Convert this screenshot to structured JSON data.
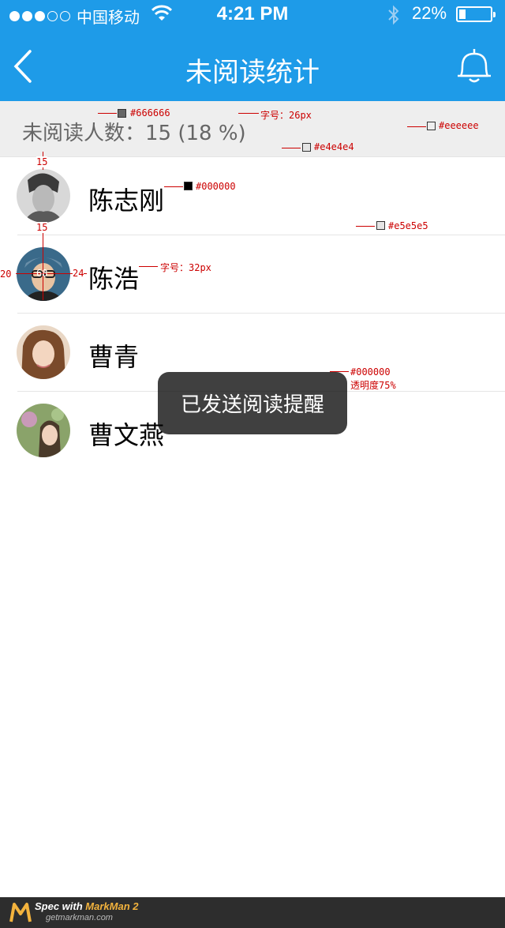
{
  "status_bar": {
    "carrier": "中国移动",
    "time": "4:21 PM",
    "battery_text": "22%",
    "battery_level": 0.22,
    "signal_filled": 3,
    "signal_total": 5
  },
  "nav": {
    "title": "未阅读统计",
    "icons": {
      "back": "chevron-left-icon",
      "notify": "bell-icon"
    }
  },
  "summary": {
    "text": "未阅读人数：15 (18 %)"
  },
  "users": [
    {
      "name": "陈志刚"
    },
    {
      "name": "陈浩"
    },
    {
      "name": "曹青"
    },
    {
      "name": "曹文燕"
    }
  ],
  "toast": {
    "text": "已发送阅读提醒"
  },
  "annotations": {
    "summary_color": "#666666",
    "summary_font": "字号：26px",
    "summary_bg": "#eeeeee",
    "summary_border": "#e4e4e4",
    "name_color": "#000000",
    "row_separator": "#e5e5e5",
    "name_font": "字号：32px",
    "toast_color": "#000000",
    "toast_opacity": "透明度75%",
    "spacing_top": "15",
    "spacing_between": "15",
    "avatar_left": "20",
    "avatar_size": "68",
    "avatar_gap": "24"
  },
  "footer": {
    "spec_text": "Spec with ",
    "brand": "MarkMan 2",
    "url": "getmarkman.com"
  },
  "colors": {
    "primary": "#1e9be8",
    "summary_bg": "#eeeeee",
    "divider": "#e5e5e5"
  }
}
